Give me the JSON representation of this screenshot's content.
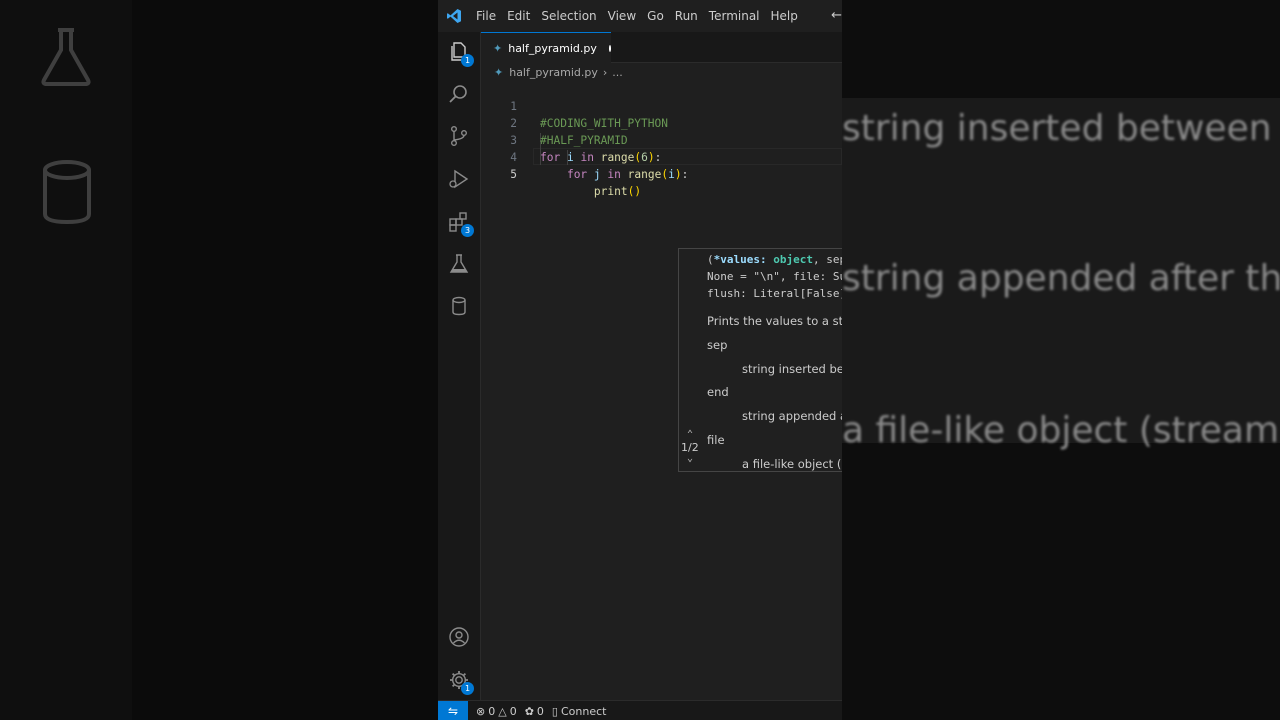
{
  "menu": {
    "items": [
      "File",
      "Edit",
      "Selection",
      "View",
      "Go",
      "Run",
      "Terminal",
      "Help"
    ]
  },
  "activity_bar": {
    "explorer_badge": "1",
    "extensions_badge": "3",
    "manage_badge": "1"
  },
  "tab": {
    "filename": "half_pyramid.py"
  },
  "breadcrumb": {
    "file": "half_pyramid.py",
    "more": "..."
  },
  "editor": {
    "lines": [
      {
        "num": "1",
        "text": "#CODING_WITH_PYTHON"
      },
      {
        "num": "2",
        "text": "#HALF_PYRAMID"
      },
      {
        "num": "3",
        "text": "for i in range(6):"
      },
      {
        "num": "4",
        "text": "    for j in range(i):"
      },
      {
        "num": "5",
        "text": "        print()"
      }
    ],
    "active_line": 5
  },
  "hover": {
    "signature_line1_prefix": "(",
    "signature_line1_param": "*values",
    "signature_line1_type": "object",
    "signature_line1_rest": ", sep: str",
    "signature_line2": "None = \"\\n\", file: Support",
    "signature_line3": "flush: Literal[False] = Fa",
    "description": "Prints the values to a stream, or t",
    "params": [
      {
        "name": "sep",
        "desc": "string inserted between va"
      },
      {
        "name": "end",
        "desc": "string appended after the"
      },
      {
        "name": "file",
        "desc": "a file-like object (stream); c"
      }
    ],
    "overload_counter": "1/2"
  },
  "statusbar": {
    "errors": "0",
    "warnings": "0",
    "ports": "0",
    "connect_label": "Connect"
  },
  "background_ghost": {
    "line1": "string inserted between va",
    "line2": "string appended after the",
    "line3": "a file-like object (stream); c"
  },
  "colors": {
    "accent": "#0078d4",
    "comment": "#6a9955",
    "keyword": "#c586c0",
    "function": "#dcdcaa",
    "variable": "#9cdcfe",
    "number": "#b5cea8"
  }
}
